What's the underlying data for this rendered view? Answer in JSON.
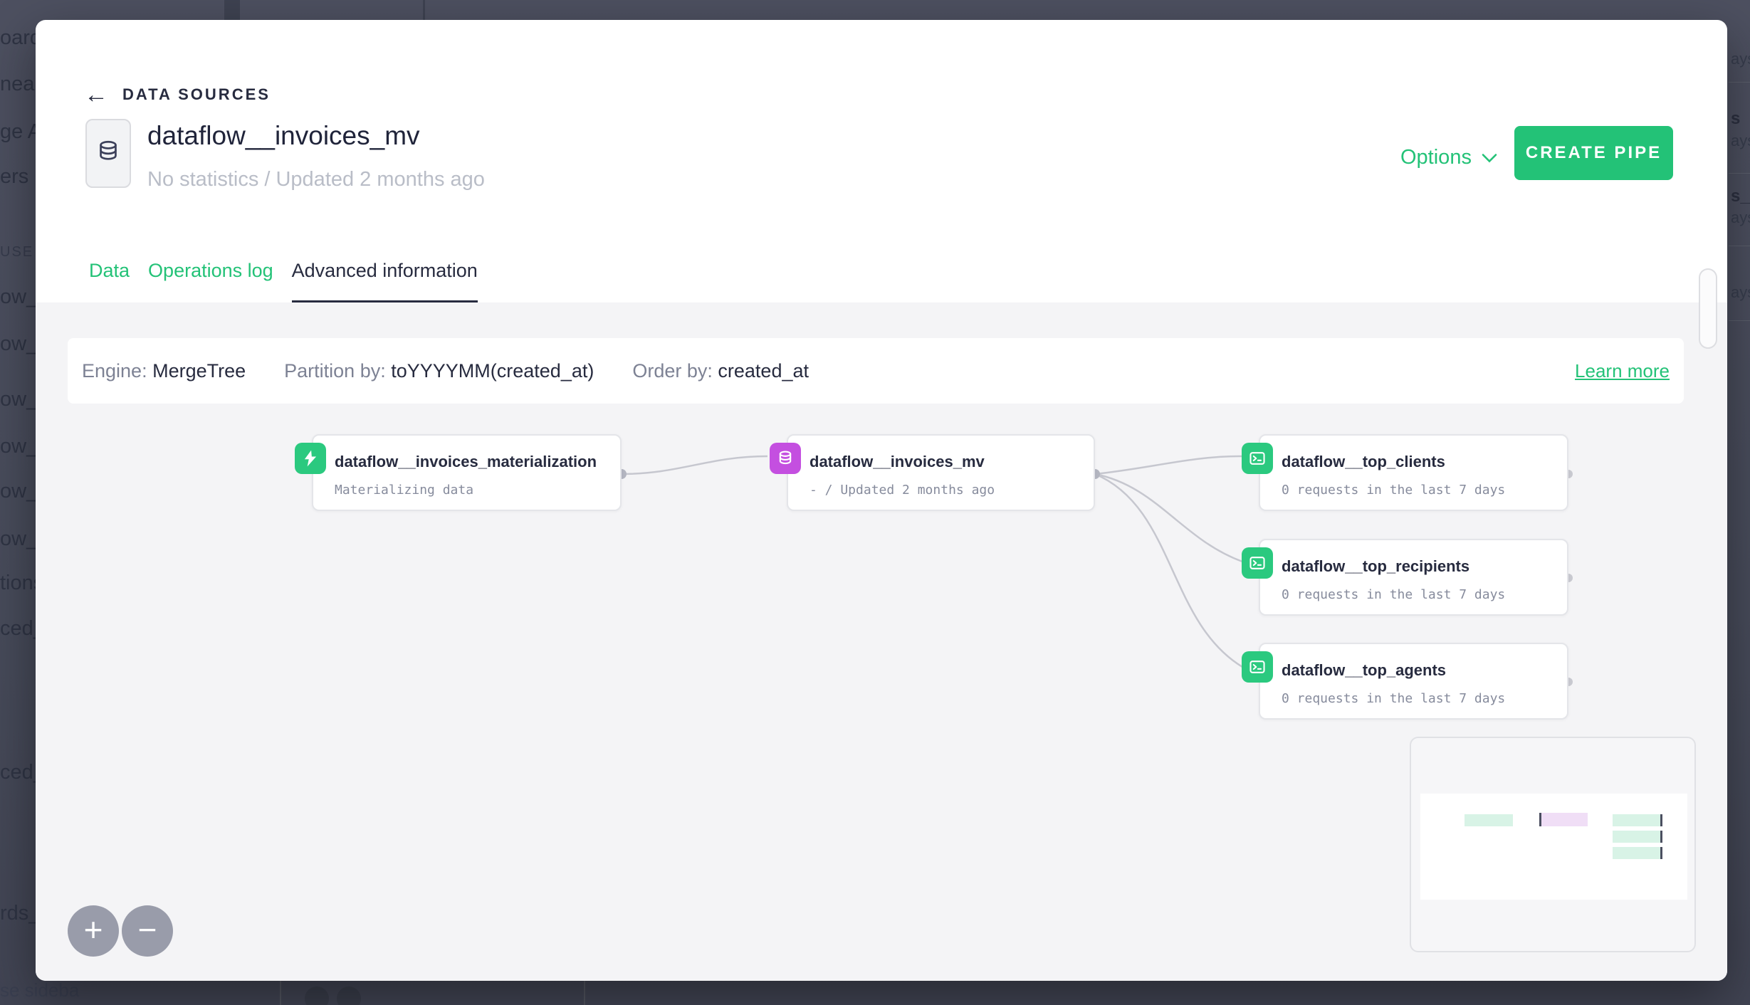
{
  "colors": {
    "brand_green": "#23c277",
    "icon_green": "#2bc97f",
    "icon_purple": "#c44fe0",
    "ink": "#272b3f",
    "canvas_gray": "#f4f4f6"
  },
  "background": {
    "left_fragments": [
      "oard",
      "nea",
      "ge A",
      "ers",
      "USE",
      "ow__",
      "ow__",
      "ow__",
      "ow__",
      "ow__",
      "ow__",
      "tions",
      "ced_",
      "ced_",
      "rds_",
      "se sideba"
    ],
    "right_fragments": [
      "ays",
      "s",
      "ays",
      "s__",
      "ays",
      "ays"
    ]
  },
  "header": {
    "back_label": "DATA SOURCES",
    "title": "dataflow__invoices_mv",
    "subtitle": "No statistics / Updated 2 months ago",
    "options_label": "Options",
    "create_pipe_label": "CREATE PIPE"
  },
  "tabs": {
    "data": "Data",
    "operations_log": "Operations log",
    "advanced_information": "Advanced information"
  },
  "infobar": {
    "engine_label": "Engine:",
    "engine_value": "MergeTree",
    "partition_label": "Partition by:",
    "partition_value": "toYYYYMM(created_at)",
    "order_label": "Order by:",
    "order_value": "created_at",
    "learn_more": "Learn more"
  },
  "graph": {
    "nodes": [
      {
        "id": "materialization",
        "icon": "lightning-icon",
        "title": "dataflow__invoices_materialization",
        "subtitle": "Materializing data"
      },
      {
        "id": "invoices_mv",
        "icon": "database-icon",
        "title": "dataflow__invoices_mv",
        "subtitle": "- / Updated 2 months ago"
      },
      {
        "id": "top_clients",
        "icon": "pipe-icon",
        "title": "dataflow__top_clients",
        "subtitle": "0 requests in the last 7 days"
      },
      {
        "id": "top_recipients",
        "icon": "pipe-icon",
        "title": "dataflow__top_recipients",
        "subtitle": "0 requests in the last 7 days"
      },
      {
        "id": "top_agents",
        "icon": "pipe-icon",
        "title": "dataflow__top_agents",
        "subtitle": "0 requests in the last 7 days"
      }
    ],
    "zoom_in": "+",
    "zoom_out": "−"
  }
}
